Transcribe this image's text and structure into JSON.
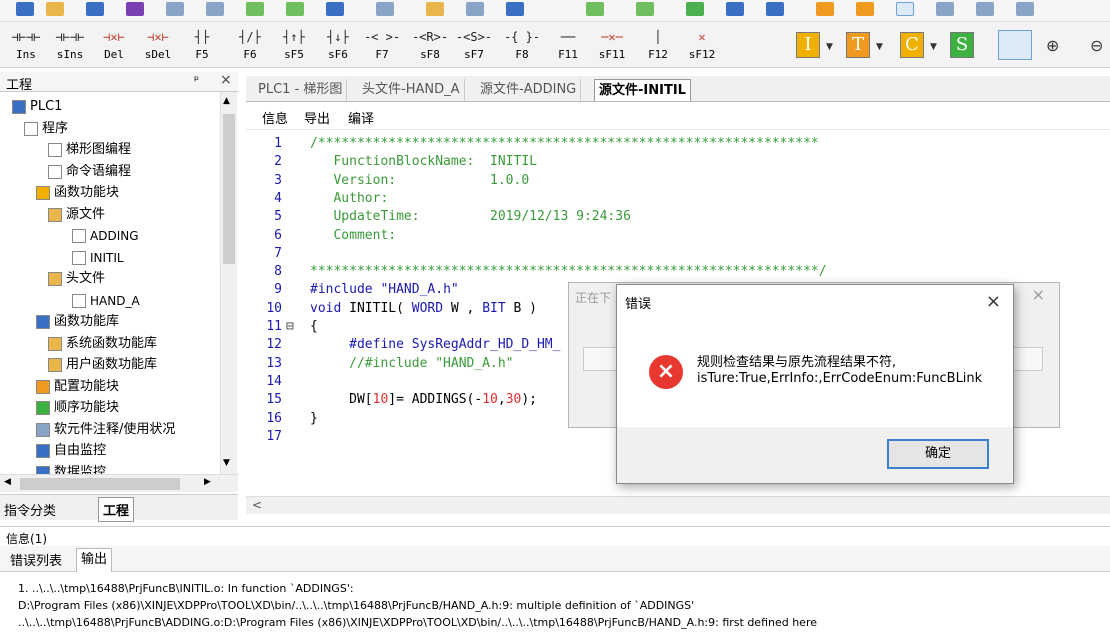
{
  "toolbar2": {
    "buttons": [
      {
        "sym": "⊣⊢⊣⊢",
        "label": "Ins"
      },
      {
        "sym": "⊣⊢⊣⊢",
        "label": "sIns"
      },
      {
        "sym": "⊣✕⊢",
        "label": "Del",
        "red": true
      },
      {
        "sym": "⊣✕⊢",
        "label": "sDel",
        "red": true
      },
      {
        "sym": "┤├",
        "label": "F5"
      },
      {
        "sym": "┤/├",
        "label": "F6"
      },
      {
        "sym": "┤↑├",
        "label": "sF5"
      },
      {
        "sym": "┤↓├",
        "label": "sF6"
      },
      {
        "sym": "-< >-",
        "label": "F7"
      },
      {
        "sym": "-<R>-",
        "label": "sF8"
      },
      {
        "sym": "-<S>-",
        "label": "sF7"
      },
      {
        "sym": "-{ }-",
        "label": "F8"
      },
      {
        "sym": "──",
        "label": "F11"
      },
      {
        "sym": "─✕─",
        "label": "sF11",
        "red": true
      },
      {
        "sym": "│",
        "label": "F12"
      },
      {
        "sym": "✕",
        "label": "sF12",
        "red": true
      }
    ],
    "instr_buttons": [
      {
        "letter": "I",
        "color": "#f0b000"
      },
      {
        "letter": "T",
        "color": "#f09a20"
      },
      {
        "letter": "C",
        "color": "#f0b000"
      },
      {
        "letter": "S",
        "color": "#3cb040"
      }
    ],
    "zoom_in": "🔍︎+",
    "zoom_out": "🔍︎-"
  },
  "project_panel": {
    "title": "工程",
    "pin": "ᵖ",
    "close": "×",
    "tree": [
      {
        "label": "PLC1",
        "indent": 0
      },
      {
        "label": "程序",
        "indent": 1
      },
      {
        "label": "梯形图编程",
        "indent": 3
      },
      {
        "label": "命令语编程",
        "indent": 3
      },
      {
        "label": "函数功能块",
        "indent": 2
      },
      {
        "label": "源文件",
        "indent": 3
      },
      {
        "label": "ADDING",
        "indent": 5
      },
      {
        "label": "INITIL",
        "indent": 5
      },
      {
        "label": "头文件",
        "indent": 3
      },
      {
        "label": "HAND_A",
        "indent": 5
      },
      {
        "label": "函数功能库",
        "indent": 2
      },
      {
        "label": "系统函数功能库",
        "indent": 3
      },
      {
        "label": "用户函数功能库",
        "indent": 3
      },
      {
        "label": "配置功能块",
        "indent": 2
      },
      {
        "label": "顺序功能块",
        "indent": 2
      },
      {
        "label": "软元件注释/使用状况",
        "indent": 2
      },
      {
        "label": "自由监控",
        "indent": 2
      },
      {
        "label": "数据监控",
        "indent": 2
      }
    ],
    "bottom_tabs": [
      "指令分类",
      "工程"
    ]
  },
  "editor": {
    "tabs": [
      "PLC1 - 梯形图",
      "头文件-HAND_A",
      "源文件-ADDING",
      "源文件-INITIL"
    ],
    "menu": [
      "信息",
      "导出",
      "编译"
    ],
    "lines": [
      {
        "n": "1",
        "segs": [
          {
            "c": "cmt",
            "t": "/****************************************************************"
          }
        ]
      },
      {
        "n": "2",
        "segs": [
          {
            "c": "cmt",
            "t": "   FunctionBlockName:  INITIL"
          }
        ]
      },
      {
        "n": "3",
        "segs": [
          {
            "c": "cmt",
            "t": "   Version:            1.0.0"
          }
        ]
      },
      {
        "n": "4",
        "segs": [
          {
            "c": "cmt",
            "t": "   Author:"
          }
        ]
      },
      {
        "n": "5",
        "segs": [
          {
            "c": "cmt",
            "t": "   UpdateTime:         2019/12/13 9:24:36"
          }
        ]
      },
      {
        "n": "6",
        "segs": [
          {
            "c": "cmt",
            "t": "   Comment:"
          }
        ]
      },
      {
        "n": "7",
        "segs": []
      },
      {
        "n": "8",
        "segs": [
          {
            "c": "cmt",
            "t": "*****************************************************************/"
          }
        ]
      },
      {
        "n": "9",
        "segs": [
          {
            "c": "kw",
            "t": "#include "
          },
          {
            "c": "str",
            "t": "\"HAND_A.h\""
          }
        ]
      },
      {
        "n": "10",
        "segs": [
          {
            "c": "kw",
            "t": "void"
          },
          {
            "c": "",
            "t": " INITIL( "
          },
          {
            "c": "kw",
            "t": "WORD"
          },
          {
            "c": "",
            "t": " W , "
          },
          {
            "c": "kw",
            "t": "BIT"
          },
          {
            "c": "",
            "t": " B )"
          }
        ]
      },
      {
        "n": "11",
        "segs": [
          {
            "c": "",
            "t": "{"
          }
        ]
      },
      {
        "n": "12",
        "segs": [
          {
            "c": "kw",
            "t": "     #define SysRegAddr_HD_D_HM_"
          }
        ]
      },
      {
        "n": "13",
        "segs": [
          {
            "c": "cmt",
            "t": "     //#include \"HAND_A.h\""
          }
        ]
      },
      {
        "n": "14",
        "segs": []
      },
      {
        "n": "15",
        "segs": [
          {
            "c": "",
            "t": "     DW["
          },
          {
            "c": "num",
            "t": "10"
          },
          {
            "c": "",
            "t": "]= ADDINGS(-"
          },
          {
            "c": "num",
            "t": "10"
          },
          {
            "c": "",
            "t": ","
          },
          {
            "c": "num",
            "t": "30"
          },
          {
            "c": "",
            "t": ");"
          }
        ]
      },
      {
        "n": "16",
        "segs": [
          {
            "c": "",
            "t": "}"
          }
        ]
      },
      {
        "n": "17",
        "segs": []
      }
    ]
  },
  "info": {
    "header": "信息(1)",
    "tabs": [
      "错误列表",
      "输出"
    ],
    "lines": [
      "1. ..\\..\\..\\tmp\\16488\\PrjFuncB\\INITIL.o: In function `ADDINGS':",
      "D:\\Program Files (x86)\\XINJE\\XDPPro\\TOOL\\XD\\bin/..\\..\\..\\tmp\\16488\\PrjFuncB/HAND_A.h:9: multiple definition of `ADDINGS'",
      "..\\..\\..\\tmp\\16488\\PrjFuncB\\ADDING.o:D:\\Program Files (x86)\\XINJE\\XDPPro\\TOOL\\XD\\bin/..\\..\\..\\tmp\\16488\\PrjFuncB/HAND_A.h:9: first defined here"
    ]
  },
  "bg_dialog": {
    "title": "正在下",
    "close": "×"
  },
  "error_dialog": {
    "title": "错误",
    "close": "×",
    "icon": "×",
    "message_line1": "规则检查结果与原先流程结果不符,",
    "message_line2": "isTure:True,ErrInfo:,ErrCodeEnum:FuncBLink",
    "ok_label": "确定"
  }
}
